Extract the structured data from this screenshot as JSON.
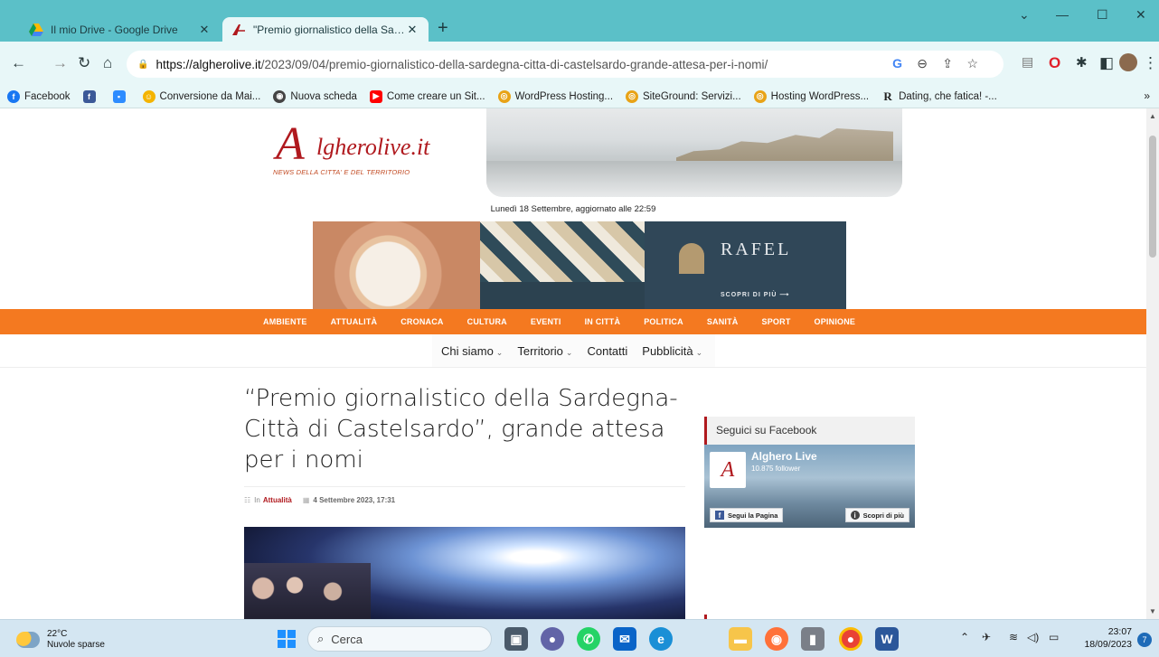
{
  "browser": {
    "tabs": [
      {
        "title": "Il mio Drive - Google Drive",
        "active": false
      },
      {
        "title": "\"Premio giornalistico della Sardegna-Città di Castelsardo\", grande attesa per i nomi",
        "active": true
      }
    ],
    "new_tab": "+",
    "window_controls": {
      "dropdown": "⌄",
      "minimize": "—",
      "maximize": "☐",
      "close": "✕"
    },
    "url_host": "https://algherolive.it",
    "url_path": "/2023/09/04/premio-giornalistico-della-sardegna-citta-di-castelsardo-grande-attesa-per-i-nomi/",
    "bookmarks": [
      {
        "label": "Facebook",
        "icon": "facebook-icon",
        "color": "#1877f2"
      },
      {
        "label": "",
        "icon": "facebook-square-icon",
        "color": "#3b5998"
      },
      {
        "label": "",
        "icon": "zoom-icon",
        "color": "#2d8cff"
      },
      {
        "label": "Conversione da Mai...",
        "icon": "emoji-icon",
        "color": "#f4b400"
      },
      {
        "label": "Nuova scheda",
        "icon": "chrome-icon",
        "color": "#444444"
      },
      {
        "label": "Come creare un Sit...",
        "icon": "youtube-icon",
        "color": "#ff0000"
      },
      {
        "label": "WordPress Hosting...",
        "icon": "siteground-icon",
        "color": "#e8a317"
      },
      {
        "label": "SiteGround: Servizi...",
        "icon": "siteground-icon",
        "color": "#e8a317"
      },
      {
        "label": "Hosting WordPress...",
        "icon": "siteground-icon",
        "color": "#e8a317"
      },
      {
        "label": "Dating, che fatica! -...",
        "icon": "r-icon",
        "color": "#222222"
      }
    ],
    "bookmarks_more": "»"
  },
  "site": {
    "logo_mark": "A",
    "logo_word": "lgherolive.it",
    "logo_tagline": "NEWS DELLA CITTA' E DEL TERRITORIO",
    "dateline": "Lunedì 18 Settembre, aggiornato alle 22:59",
    "banner": {
      "brand": "RAFEL",
      "cta": "SCOPRI DI PIÙ  ⟶"
    },
    "main_nav": [
      "AMBIENTE",
      "ATTUALITÀ",
      "CRONACA",
      "CULTURA",
      "EVENTI",
      "IN CITTÀ",
      "POLITICA",
      "SANITÀ",
      "SPORT",
      "OPINIONE"
    ],
    "sub_nav": [
      {
        "label": "Chi siamo",
        "chevron": true
      },
      {
        "label": "Territorio",
        "chevron": true
      },
      {
        "label": "Contatti",
        "chevron": false
      },
      {
        "label": "Pubblicità",
        "chevron": true
      }
    ],
    "chevron": "⌄",
    "accent_color": "#f47920",
    "brand_color": "#b0191e"
  },
  "article": {
    "title": "“Premio giornalistico della Sardegna-Città di Castelsardo”, grande attesa per i nomi",
    "category_prefix": "In",
    "category": "Attualità",
    "date": "4 Settembre 2023, 17:31"
  },
  "sidebar": {
    "facebook_header": "Seguici su Facebook",
    "page_name": "Alghero Live",
    "followers": "10.875 follower",
    "follow_button": "Segui la Pagina",
    "more_button": "Scopri di più"
  },
  "taskbar": {
    "temperature": "22°C",
    "weather": "Nuvole sparse",
    "search_placeholder": "Cerca",
    "time": "23:07",
    "date": "18/09/2023",
    "notifications": "7"
  }
}
